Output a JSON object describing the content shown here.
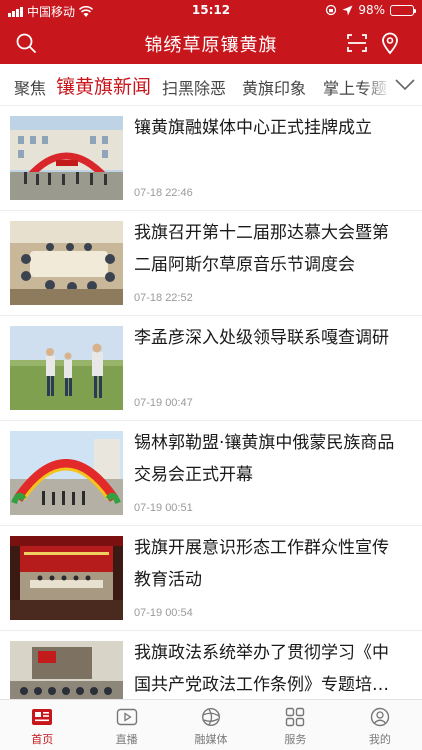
{
  "status_bar": {
    "carrier": "中国移动",
    "time": "15:12",
    "battery": "98%",
    "battery_level": 0.98
  },
  "header": {
    "title": "锦绣草原镶黄旗",
    "left_icon": "search-icon",
    "right_icons": [
      "scan-icon",
      "location-icon"
    ]
  },
  "tabs": {
    "items": [
      "聚焦",
      "镶黄旗新闻",
      "扫黑除恶",
      "黄旗印象",
      "掌上专题"
    ],
    "active_index": 1,
    "more_icon": "chevron-down-icon"
  },
  "news": [
    {
      "title": "镶黄旗融媒体中心正式挂牌成立",
      "time": "07-18 22:46"
    },
    {
      "title": "我旗召开第十二届那达慕大会暨第二届阿斯尔草原音乐节调度会",
      "time": "07-18 22:52"
    },
    {
      "title": "李孟彦深入处级领导联系嘎查调研",
      "time": "07-19 00:47"
    },
    {
      "title": "锡林郭勒盟·镶黄旗中俄蒙民族商品交易会正式开幕",
      "time": "07-19 00:51"
    },
    {
      "title": "我旗开展意识形态工作群众性宣传教育活动",
      "time": "07-19 00:54"
    },
    {
      "title": "我旗政法系统举办了贯彻学习《中国共产党政法工作条例》专题培…",
      "time": ""
    }
  ],
  "tabbar": {
    "items": [
      {
        "label": "首页",
        "icon": "newspaper-icon"
      },
      {
        "label": "直播",
        "icon": "play-icon"
      },
      {
        "label": "融媒体",
        "icon": "globe-icon"
      },
      {
        "label": "服务",
        "icon": "grid-icon"
      },
      {
        "label": "我的",
        "icon": "user-icon"
      }
    ],
    "active_index": 0
  },
  "colors": {
    "brand_red": "#c8161d",
    "text": "#1a1a1a",
    "muted": "#9a9a9a"
  }
}
